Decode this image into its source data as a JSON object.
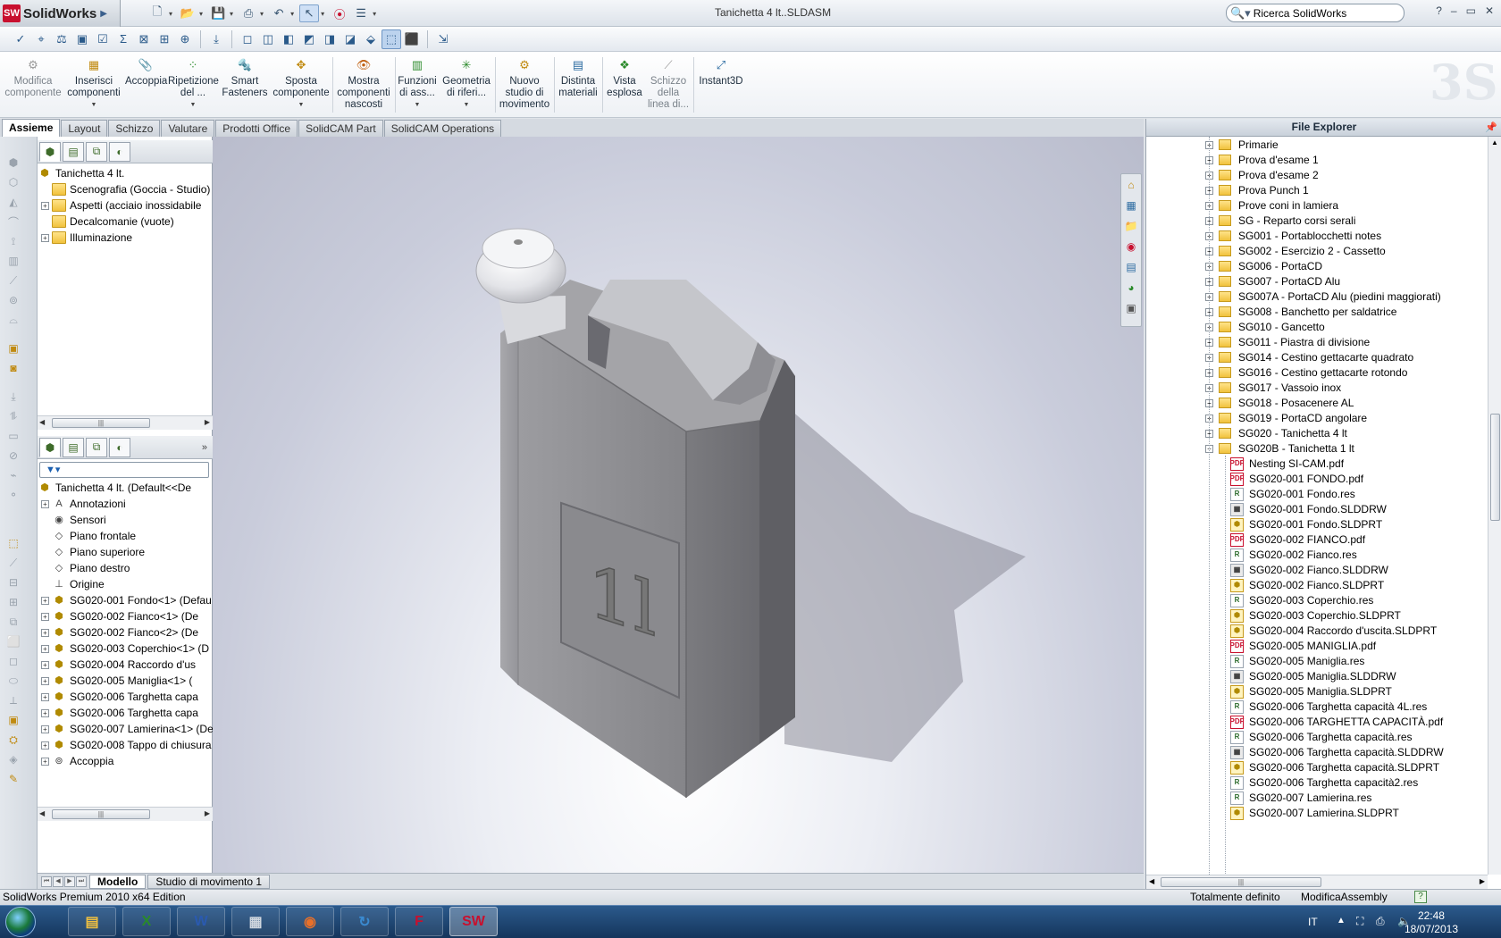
{
  "app": {
    "name": "SolidWorks",
    "logo_letters": "SW",
    "title": "Tanichetta 4 lt..SLDASM"
  },
  "search": {
    "value": "Ricerca SolidWorks"
  },
  "window_buttons": [
    "?",
    "–",
    "▭",
    "✕"
  ],
  "command_manager": [
    {
      "label": "Modifica componente",
      "icon": "edit-component-icon",
      "enabled": false
    },
    {
      "label": "Inserisci componenti",
      "icon": "insert-components-icon",
      "enabled": true,
      "dropdown": true
    },
    {
      "label": "Accoppia",
      "icon": "mate-icon",
      "enabled": true
    },
    {
      "label": "Ripetizione del ...",
      "icon": "pattern-icon",
      "enabled": true,
      "dropdown": true
    },
    {
      "label": "Smart Fasteners",
      "icon": "fasteners-icon",
      "enabled": true
    },
    {
      "label": "Sposta componente",
      "icon": "move-component-icon",
      "enabled": true,
      "dropdown": true
    },
    {
      "label": "Mostra componenti nascosti",
      "icon": "show-hidden-icon",
      "enabled": true
    },
    {
      "label": "Funzioni di ass...",
      "icon": "assembly-features-icon",
      "enabled": true,
      "dropdown": true
    },
    {
      "label": "Geometria di riferi...",
      "icon": "reference-geometry-icon",
      "enabled": true,
      "dropdown": true
    },
    {
      "label": "Nuovo studio di movimento",
      "icon": "motion-study-icon",
      "enabled": true
    },
    {
      "label": "Distinta materiali",
      "icon": "bom-icon",
      "enabled": true
    },
    {
      "label": "Vista esplosa",
      "icon": "exploded-view-icon",
      "enabled": true
    },
    {
      "label": "Schizzo della linea di...",
      "icon": "explode-line-icon",
      "enabled": false
    },
    {
      "label": "Instant3D",
      "icon": "instant3d-icon",
      "enabled": true
    }
  ],
  "tabs": [
    "Assieme",
    "Layout",
    "Schizzo",
    "Valutare",
    "Prodotti Office",
    "SolidCAM Part",
    "SolidCAM Operations"
  ],
  "display_tree": {
    "root": "Tanichetta 4 lt.",
    "items": [
      {
        "label": "Scenografia (Goccia - Studio)",
        "expand": false
      },
      {
        "label": "Aspetti (acciaio inossidabile",
        "expand": true
      },
      {
        "label": "Decalcomanie (vuote)",
        "expand": false
      },
      {
        "label": "Illuminazione",
        "expand": true
      }
    ]
  },
  "feature_tree": {
    "root": "Tanichetta 4 lt.  (Default<<De",
    "items": [
      {
        "label": "Annotazioni",
        "icon": "annotations-icon",
        "expand": true
      },
      {
        "label": "Sensori",
        "icon": "sensors-icon",
        "expand": false
      },
      {
        "label": "Piano frontale",
        "icon": "plane-icon",
        "expand": false
      },
      {
        "label": "Piano superiore",
        "icon": "plane-icon",
        "expand": false
      },
      {
        "label": "Piano destro",
        "icon": "plane-icon",
        "expand": false
      },
      {
        "label": "Origine",
        "icon": "origin-icon",
        "expand": false
      },
      {
        "label": "SG020-001 Fondo<1> (Defau",
        "icon": "part-icon",
        "expand": true
      },
      {
        "label": "SG020-002 Fianco<1> (De",
        "icon": "part-icon",
        "expand": true
      },
      {
        "label": "SG020-002 Fianco<2> (De",
        "icon": "part-icon",
        "expand": true
      },
      {
        "label": "SG020-003 Coperchio<1> (D",
        "icon": "part-icon",
        "expand": true
      },
      {
        "label": "SG020-004 Raccordo d'us",
        "icon": "part-icon",
        "expand": true
      },
      {
        "label": "SG020-005 Maniglia<1> (",
        "icon": "part-icon",
        "expand": true
      },
      {
        "label": "SG020-006 Targhetta capa",
        "icon": "part-icon",
        "expand": true
      },
      {
        "label": "SG020-006 Targhetta capa",
        "icon": "part-icon",
        "expand": true
      },
      {
        "label": "SG020-007 Lamierina<1> (De",
        "icon": "part-icon",
        "expand": true
      },
      {
        "label": "SG020-008 Tappo di chiusura",
        "icon": "part-icon",
        "expand": true
      },
      {
        "label": "Accoppia",
        "icon": "mates-icon",
        "expand": true
      }
    ]
  },
  "bottom_tabs": [
    "Modello",
    "Studio di movimento 1"
  ],
  "file_explorer": {
    "title": "File Explorer",
    "folders": [
      "Primarie",
      "Prova d'esame 1",
      "Prova d'esame 2",
      "Prova Punch 1",
      "Prove coni in lamiera",
      "SG - Reparto corsi serali",
      "SG001 - Portablocchetti notes",
      "SG002 - Esercizio 2 - Cassetto",
      "SG006 - PortaCD",
      "SG007 - PortaCD Alu",
      "SG007A - PortaCD Alu (piedini maggiorati)",
      "SG008 - Banchetto per saldatrice",
      "SG010 - Gancetto",
      "SG011 - Piastra di divisione",
      "SG014 - Cestino gettacarte quadrato",
      "SG016 - Cestino gettacarte rotondo",
      "SG017 - Vassoio inox",
      "SG018 - Posacenere AL",
      "SG019 - PortaCD angolare",
      "SG020 - Tanichetta 4 lt",
      "SG020B - Tanichetta 1 lt"
    ],
    "files": [
      {
        "name": "Nesting SI-CAM.pdf",
        "type": "pdf"
      },
      {
        "name": "SG020-001 FONDO.pdf",
        "type": "pdf"
      },
      {
        "name": "SG020-001 Fondo.res",
        "type": "res"
      },
      {
        "name": "SG020-001 Fondo.SLDDRW",
        "type": "drw"
      },
      {
        "name": "SG020-001 Fondo.SLDPRT",
        "type": "prt"
      },
      {
        "name": "SG020-002 FIANCO.pdf",
        "type": "pdf"
      },
      {
        "name": "SG020-002 Fianco.res",
        "type": "res"
      },
      {
        "name": "SG020-002 Fianco.SLDDRW",
        "type": "drw"
      },
      {
        "name": "SG020-002 Fianco.SLDPRT",
        "type": "prt"
      },
      {
        "name": "SG020-003 Coperchio.res",
        "type": "res"
      },
      {
        "name": "SG020-003 Coperchio.SLDPRT",
        "type": "prt"
      },
      {
        "name": "SG020-004 Raccordo d'uscita.SLDPRT",
        "type": "prt"
      },
      {
        "name": "SG020-005 MANIGLIA.pdf",
        "type": "pdf"
      },
      {
        "name": "SG020-005 Maniglia.res",
        "type": "res"
      },
      {
        "name": "SG020-005 Maniglia.SLDDRW",
        "type": "drw"
      },
      {
        "name": "SG020-005 Maniglia.SLDPRT",
        "type": "prt"
      },
      {
        "name": "SG020-006 Targhetta capacità 4L.res",
        "type": "res"
      },
      {
        "name": "SG020-006 TARGHETTA CAPACITÀ.pdf",
        "type": "pdf"
      },
      {
        "name": "SG020-006 Targhetta capacità.res",
        "type": "res"
      },
      {
        "name": "SG020-006 Targhetta capacità.SLDDRW",
        "type": "drw"
      },
      {
        "name": "SG020-006 Targhetta capacità.SLDPRT",
        "type": "prt"
      },
      {
        "name": "SG020-006 Targhetta capacità2.res",
        "type": "res"
      },
      {
        "name": "SG020-007 Lamierina.res",
        "type": "res"
      },
      {
        "name": "SG020-007 Lamierina.SLDPRT",
        "type": "prt"
      }
    ]
  },
  "model": {
    "plate_text": "1l"
  },
  "status": {
    "edition": "SolidWorks Premium 2010 x64 Edition",
    "definition": "Totalmente definito",
    "mode": "ModificaAssembly",
    "help": "?"
  },
  "taskbar": {
    "lang": "IT",
    "time": "22:48",
    "date": "18/07/2013",
    "apps": [
      "explorer-icon",
      "excel-icon",
      "word-icon",
      "calculator-icon",
      "firefox-icon",
      "app-icon",
      "flash-icon",
      "solidworks-icon"
    ],
    "app_glyphs": [
      "▤",
      "X",
      "W",
      "▦",
      "◉",
      "↻",
      "F",
      "SW"
    ]
  },
  "colors": {
    "accent": "#c8102e",
    "viewport_bg": "#c9ccdb",
    "model": "#8c8c8f"
  }
}
